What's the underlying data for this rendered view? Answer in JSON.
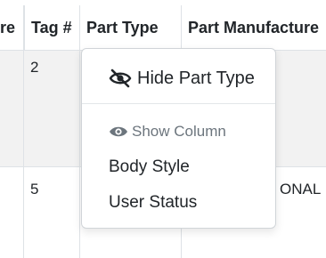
{
  "table": {
    "columns": [
      "re",
      "Tag #",
      "Part Type",
      "Part Manufacture"
    ],
    "rows": [
      {
        "tag": "2",
        "manufacturer": ""
      },
      {
        "tag": "5",
        "manufacturer": "ONAL"
      }
    ]
  },
  "menu": {
    "hide_label": "Hide Part Type",
    "hide_icon": "eye-slash-icon",
    "show_header": "Show Column",
    "show_icon": "eye-icon",
    "items": [
      "Body Style",
      "User Status"
    ]
  }
}
